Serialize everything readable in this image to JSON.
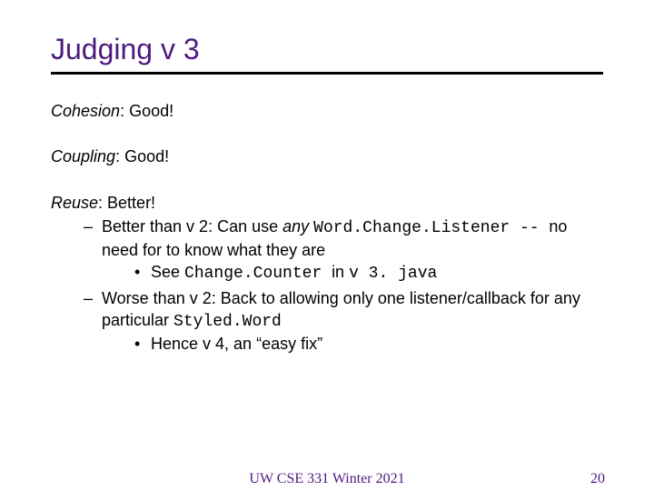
{
  "title": "Judging v 3",
  "cohesion": {
    "label": "Cohesion",
    "value": ": Good!"
  },
  "coupling": {
    "label": "Coupling",
    "value": ": Good!"
  },
  "reuse": {
    "label": "Reuse",
    "value": ": Better!",
    "b1_a": "Better than v 2: Can use ",
    "b1_any": "any ",
    "b1_code": "Word.Change.Listener ",
    "b1_dash": "-- ",
    "b1_b": "no need for to know what they are",
    "b1s_a": "See ",
    "b1s_code1": "Change.Counter ",
    "b1s_mid": "in ",
    "b1s_code2": "v 3. java",
    "b2_a": "Worse than v 2: Back to allowing only one listener/callback for any particular ",
    "b2_code": "Styled.Word",
    "b2s": "Hence v 4, an “easy fix”"
  },
  "footer": {
    "center": "UW CSE 331 Winter 2021",
    "page": "20"
  }
}
